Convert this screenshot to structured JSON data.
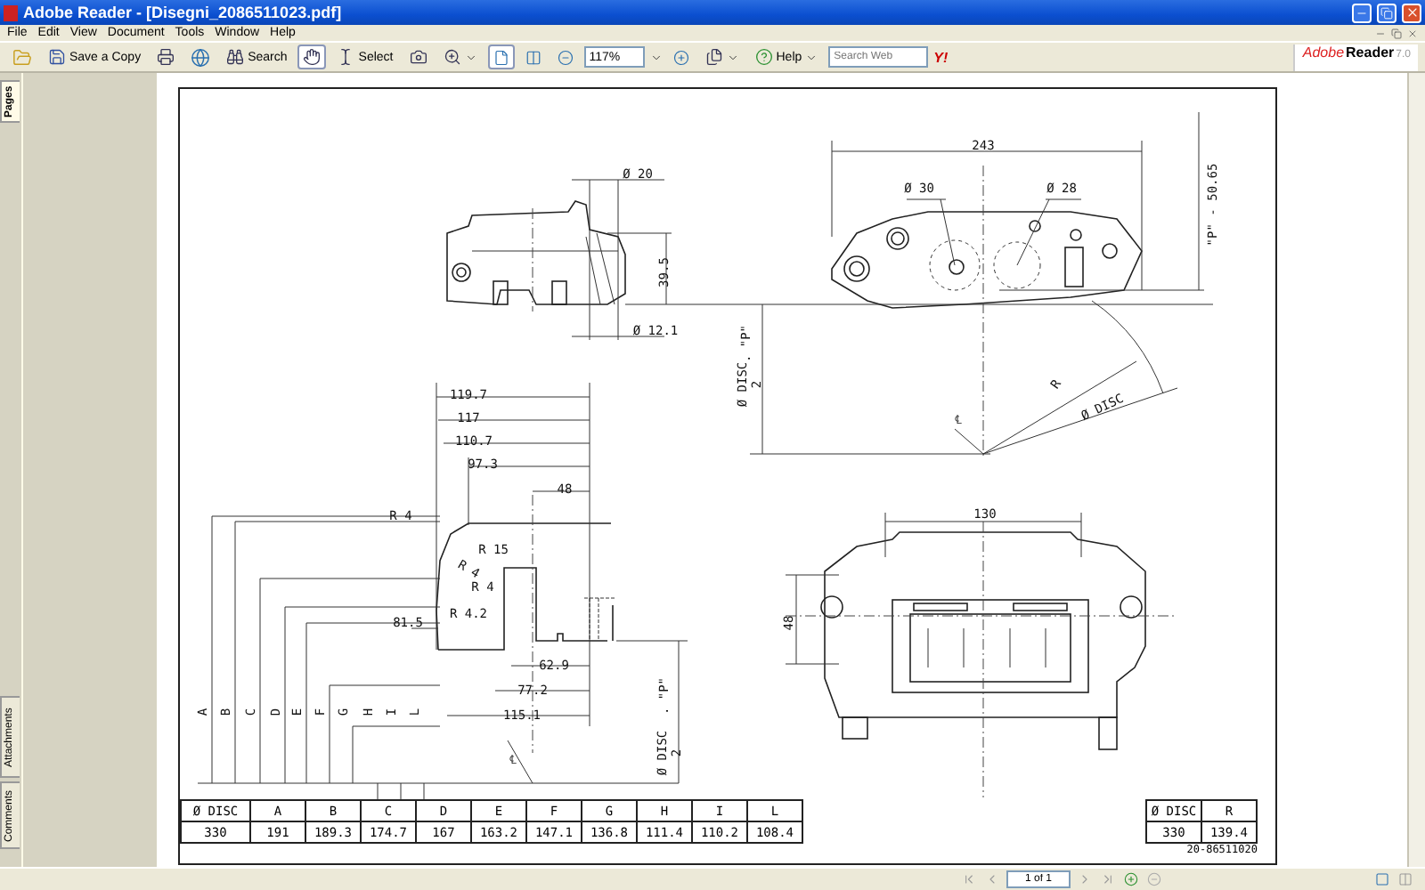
{
  "window": {
    "title": "Adobe Reader - [Disegni_2086511023.pdf]"
  },
  "menu": [
    "File",
    "Edit",
    "View",
    "Document",
    "Tools",
    "Window",
    "Help"
  ],
  "toolbar": [
    {
      "kind": "open"
    },
    {
      "kind": "save",
      "label": "Save a Copy"
    },
    {
      "kind": "print"
    },
    {
      "kind": "email"
    },
    {
      "kind": "search",
      "label": "Search"
    },
    {
      "kind": "hand",
      "selected": true
    },
    {
      "kind": "select",
      "label": "Select",
      "selected": false
    },
    {
      "kind": "snapshot",
      "selected": false
    },
    {
      "kind": "zoom",
      "selected": false
    },
    {
      "kind": "fitpage",
      "selected": true
    },
    {
      "kind": "fitwidth",
      "selected": false
    },
    {
      "kind": "zoomout"
    },
    {
      "kind": "zoomvalue",
      "value": "117%"
    },
    {
      "kind": "zoomin"
    },
    {
      "kind": "pages"
    },
    {
      "kind": "help",
      "label": "Help"
    },
    {
      "kind": "websearch",
      "placeholder": "Search Web"
    },
    {
      "kind": "yahoo",
      "label": "Y!"
    }
  ],
  "brand": {
    "name": "Adobe",
    "product": "Reader",
    "version": "7.0"
  },
  "side_tabs": [
    {
      "label": "Pages",
      "selected": true
    },
    {
      "label": "Attachments",
      "selected": false
    },
    {
      "label": "Comments",
      "selected": false
    }
  ],
  "drawing": {
    "labels": [
      "243",
      "\"P\" - 50.65",
      "Ø 20",
      "Ø 30",
      "Ø 28",
      "39.5",
      "Ø 12.1",
      "Ø DISC",
      "2",
      ". \"P\"",
      "R",
      "Ø DISC",
      "℄",
      "119.7",
      "117",
      "110.7",
      "97.3",
      "48",
      "R 4",
      "R 15",
      "R 4",
      "R 4",
      "81.5",
      "R 4.2",
      "62.9",
      "77.2",
      "115.1",
      "Ø DISC",
      "2",
      ". \"P\"",
      "℄",
      "A",
      "B",
      "C",
      "D",
      "E",
      "F",
      "G",
      "H",
      "I",
      "L",
      "130",
      "48"
    ]
  },
  "dimension_table": [
    {
      "header": "Ø DISC",
      "value": "330"
    },
    {
      "header": "A",
      "value": "191"
    },
    {
      "header": "B",
      "value": "189.3"
    },
    {
      "header": "C",
      "value": "174.7"
    },
    {
      "header": "D",
      "value": "167"
    },
    {
      "header": "E",
      "value": "163.2"
    },
    {
      "header": "F",
      "value": "147.1"
    },
    {
      "header": "G",
      "value": "136.8"
    },
    {
      "header": "H",
      "value": "111.4"
    },
    {
      "header": "I",
      "value": "110.2"
    },
    {
      "header": "L",
      "value": "108.4"
    }
  ],
  "radius_table": [
    {
      "header": "Ø DISC",
      "value": "330"
    },
    {
      "header": "R",
      "value": "139.4"
    }
  ],
  "drawing_number": "20-86511020",
  "status_bar": {
    "page": "1 of 1"
  }
}
